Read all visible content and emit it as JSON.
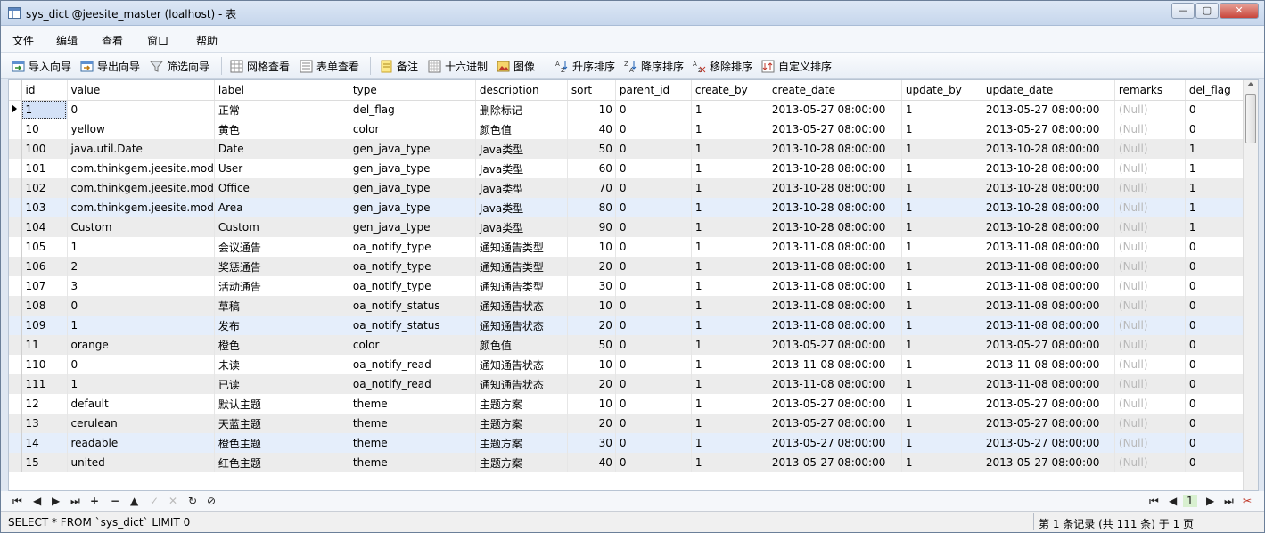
{
  "window": {
    "title": "sys_dict @jeesite_master (loalhost) - 表",
    "min": "—",
    "max": "▢",
    "close": "✕"
  },
  "menu": [
    "文件",
    "编辑",
    "查看",
    "窗口",
    "帮助"
  ],
  "toolbar": {
    "import": "导入向导",
    "export": "导出向导",
    "filter": "筛选向导",
    "grid_view": "网格查看",
    "form_view": "表单查看",
    "memo": "备注",
    "hex": "十六进制",
    "image": "图像",
    "sort_asc": "升序排序",
    "sort_desc": "降序排序",
    "remove_sort": "移除排序",
    "custom_sort": "自定义排序"
  },
  "grid": {
    "columns": [
      "id",
      "value",
      "label",
      "type",
      "description",
      "sort",
      "parent_id",
      "create_by",
      "create_date",
      "update_by",
      "update_date",
      "remarks",
      "del_flag"
    ],
    "rows": [
      [
        "1",
        "0",
        "正常",
        "del_flag",
        "删除标记",
        "10",
        "0",
        "1",
        "2013-05-27 08:00:00",
        "1",
        "2013-05-27 08:00:00",
        "(Null)",
        "0"
      ],
      [
        "10",
        "yellow",
        "黄色",
        "color",
        "颜色值",
        "40",
        "0",
        "1",
        "2013-05-27 08:00:00",
        "1",
        "2013-05-27 08:00:00",
        "(Null)",
        "0"
      ],
      [
        "100",
        "java.util.Date",
        "Date",
        "gen_java_type",
        "Java类型",
        "50",
        "0",
        "1",
        "2013-10-28 08:00:00",
        "1",
        "2013-10-28 08:00:00",
        "(Null)",
        "1"
      ],
      [
        "101",
        "com.thinkgem.jeesite.mod",
        "User",
        "gen_java_type",
        "Java类型",
        "60",
        "0",
        "1",
        "2013-10-28 08:00:00",
        "1",
        "2013-10-28 08:00:00",
        "(Null)",
        "1"
      ],
      [
        "102",
        "com.thinkgem.jeesite.mod",
        "Office",
        "gen_java_type",
        "Java类型",
        "70",
        "0",
        "1",
        "2013-10-28 08:00:00",
        "1",
        "2013-10-28 08:00:00",
        "(Null)",
        "1"
      ],
      [
        "103",
        "com.thinkgem.jeesite.mod",
        "Area",
        "gen_java_type",
        "Java类型",
        "80",
        "0",
        "1",
        "2013-10-28 08:00:00",
        "1",
        "2013-10-28 08:00:00",
        "(Null)",
        "1"
      ],
      [
        "104",
        "Custom",
        "Custom",
        "gen_java_type",
        "Java类型",
        "90",
        "0",
        "1",
        "2013-10-28 08:00:00",
        "1",
        "2013-10-28 08:00:00",
        "(Null)",
        "1"
      ],
      [
        "105",
        "1",
        "会议通告",
        "oa_notify_type",
        "通知通告类型",
        "10",
        "0",
        "1",
        "2013-11-08 08:00:00",
        "1",
        "2013-11-08 08:00:00",
        "(Null)",
        "0"
      ],
      [
        "106",
        "2",
        "奖惩通告",
        "oa_notify_type",
        "通知通告类型",
        "20",
        "0",
        "1",
        "2013-11-08 08:00:00",
        "1",
        "2013-11-08 08:00:00",
        "(Null)",
        "0"
      ],
      [
        "107",
        "3",
        "活动通告",
        "oa_notify_type",
        "通知通告类型",
        "30",
        "0",
        "1",
        "2013-11-08 08:00:00",
        "1",
        "2013-11-08 08:00:00",
        "(Null)",
        "0"
      ],
      [
        "108",
        "0",
        "草稿",
        "oa_notify_status",
        "通知通告状态",
        "10",
        "0",
        "1",
        "2013-11-08 08:00:00",
        "1",
        "2013-11-08 08:00:00",
        "(Null)",
        "0"
      ],
      [
        "109",
        "1",
        "发布",
        "oa_notify_status",
        "通知通告状态",
        "20",
        "0",
        "1",
        "2013-11-08 08:00:00",
        "1",
        "2013-11-08 08:00:00",
        "(Null)",
        "0"
      ],
      [
        "11",
        "orange",
        "橙色",
        "color",
        "颜色值",
        "50",
        "0",
        "1",
        "2013-05-27 08:00:00",
        "1",
        "2013-05-27 08:00:00",
        "(Null)",
        "0"
      ],
      [
        "110",
        "0",
        "未读",
        "oa_notify_read",
        "通知通告状态",
        "10",
        "0",
        "1",
        "2013-11-08 08:00:00",
        "1",
        "2013-11-08 08:00:00",
        "(Null)",
        "0"
      ],
      [
        "111",
        "1",
        "已读",
        "oa_notify_read",
        "通知通告状态",
        "20",
        "0",
        "1",
        "2013-11-08 08:00:00",
        "1",
        "2013-11-08 08:00:00",
        "(Null)",
        "0"
      ],
      [
        "12",
        "default",
        "默认主题",
        "theme",
        "主题方案",
        "10",
        "0",
        "1",
        "2013-05-27 08:00:00",
        "1",
        "2013-05-27 08:00:00",
        "(Null)",
        "0"
      ],
      [
        "13",
        "cerulean",
        "天蓝主题",
        "theme",
        "主题方案",
        "20",
        "0",
        "1",
        "2013-05-27 08:00:00",
        "1",
        "2013-05-27 08:00:00",
        "(Null)",
        "0"
      ],
      [
        "14",
        "readable",
        "橙色主题",
        "theme",
        "主题方案",
        "30",
        "0",
        "1",
        "2013-05-27 08:00:00",
        "1",
        "2013-05-27 08:00:00",
        "(Null)",
        "0"
      ],
      [
        "15",
        "united",
        "红色主题",
        "theme",
        "主题方案",
        "40",
        "0",
        "1",
        "2013-05-27 08:00:00",
        "1",
        "2013-05-27 08:00:00",
        "(Null)",
        "0"
      ]
    ]
  },
  "nav": {
    "page": "1"
  },
  "status": {
    "sql": "SELECT * FROM `sys_dict` LIMIT 0",
    "record": "第 1 条记录 (共 111 条) 于 1 页"
  },
  "colors": {
    "selected_row": "#e5eefb",
    "alt_row": "#ececec",
    "null_text": "#b8b8b8"
  }
}
